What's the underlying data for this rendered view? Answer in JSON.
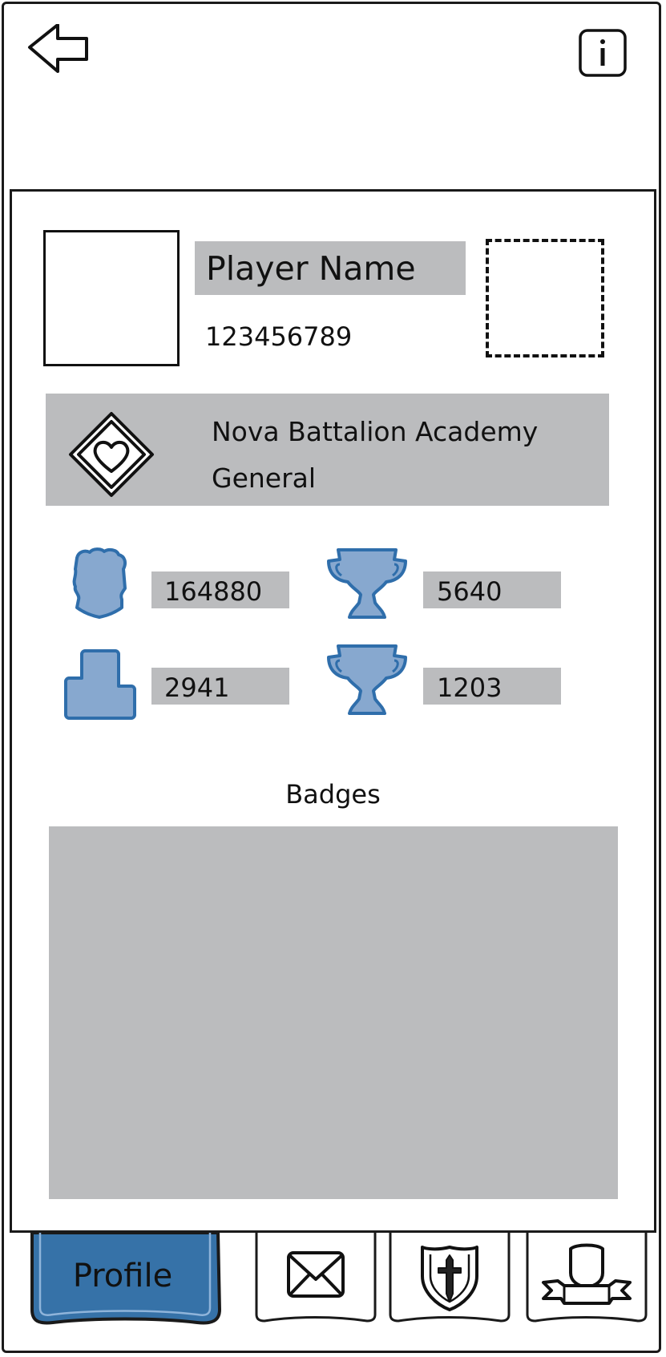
{
  "header": {
    "back_icon": "back-arrow-icon",
    "info_icon": "info-icon"
  },
  "profile": {
    "player_name": "Player Name",
    "player_id": "123456789"
  },
  "guild": {
    "icon": "heart-diamond-icon",
    "name": "Nova Battalion Academy",
    "rank": "General"
  },
  "stats": [
    {
      "icon": "fist-icon",
      "value": "164880"
    },
    {
      "icon": "trophy-icon",
      "value": "5640"
    },
    {
      "icon": "block-icon",
      "value": "2941"
    },
    {
      "icon": "trophy-icon",
      "value": "1203"
    }
  ],
  "badges": {
    "title": "Badges"
  },
  "tabs": [
    {
      "label": "Profile",
      "active": true
    },
    {
      "label": "",
      "icon": "envelope-icon"
    },
    {
      "label": "",
      "icon": "shield-sword-icon"
    },
    {
      "label": "",
      "icon": "banner-crest-icon"
    }
  ],
  "colors": {
    "accent": "#3672a8",
    "icon_fill": "#87a8cf",
    "icon_stroke": "#2f6eab",
    "bar": "#bbbcbe"
  }
}
